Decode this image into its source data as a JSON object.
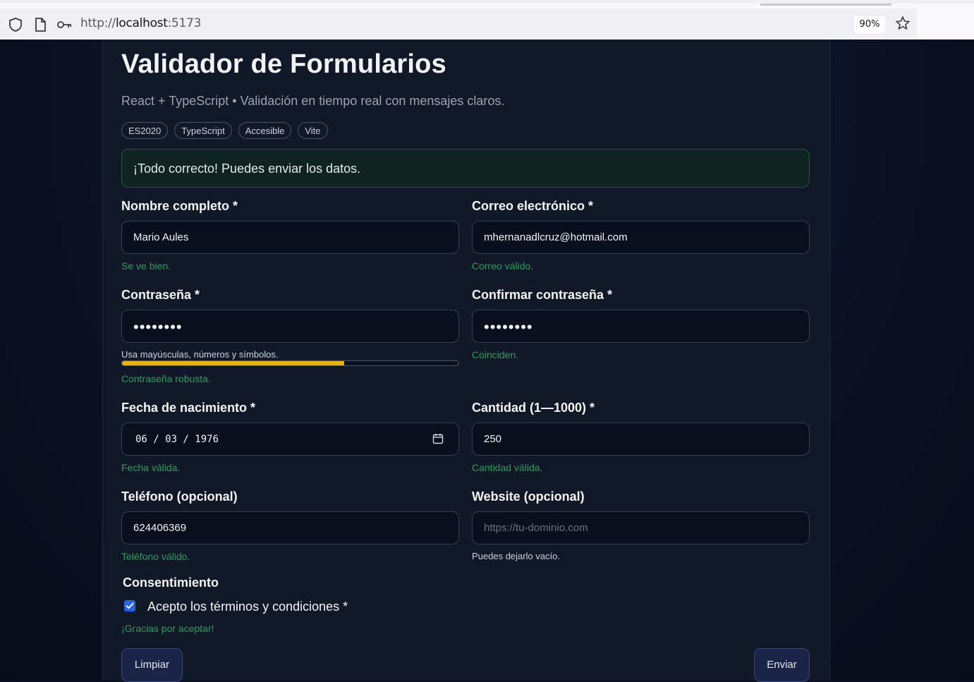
{
  "browser": {
    "url_scheme": "http://",
    "url_host": "localhost",
    "url_port": ":5173",
    "zoom": "90%"
  },
  "header": {
    "title": "Validador de Formularios",
    "subtitle": "React + TypeScript • Validación en tiempo real con mensajes claros.",
    "chips": [
      "ES2020",
      "TypeScript",
      "Accesible",
      "Vite"
    ]
  },
  "alert": {
    "message": "¡Todo correcto! Puedes enviar los datos."
  },
  "form": {
    "name": {
      "label": "Nombre completo *",
      "value": "Mario Aules",
      "hint": "Se ve bien."
    },
    "email": {
      "label": "Correo electrónico *",
      "value": "mhernanadlcruz@hotmail.com",
      "hint": "Correo válido."
    },
    "password": {
      "label": "Contraseña *",
      "value": "••••••••",
      "help": "Usa mayúsculas, números y símbolos.",
      "strength": 0.66,
      "hint": "Contraseña robusta."
    },
    "confirm": {
      "label": "Confirmar contraseña *",
      "value": "••••••••",
      "hint": "Coinciden."
    },
    "birthdate": {
      "label": "Fecha de nacimiento *",
      "value": "06 / 03 / 1976",
      "hint": "Fecha válida."
    },
    "quantity": {
      "label": "Cantidad (1—1000) *",
      "value": "250",
      "hint": "Cantidad válida."
    },
    "phone": {
      "label": "Teléfono (opcional)",
      "value": "624406369",
      "hint": "Teléfono válido."
    },
    "website": {
      "label": "Website (opcional)",
      "placeholder": "https://tu-dominio.com",
      "hint": "Puedes dejarlo vacío."
    }
  },
  "consent": {
    "title": "Consentimiento",
    "checkbox_label": "Acepto los términos y condiciones *",
    "checked": true,
    "hint": "¡Gracias por aceptar!"
  },
  "actions": {
    "clear_label": "Limpiar",
    "submit_label": "Enviar"
  },
  "colors": {
    "success": "#22a05b",
    "strength_bar": "#eab308",
    "checkbox": "#2563eb",
    "card_bg": "#111827"
  }
}
